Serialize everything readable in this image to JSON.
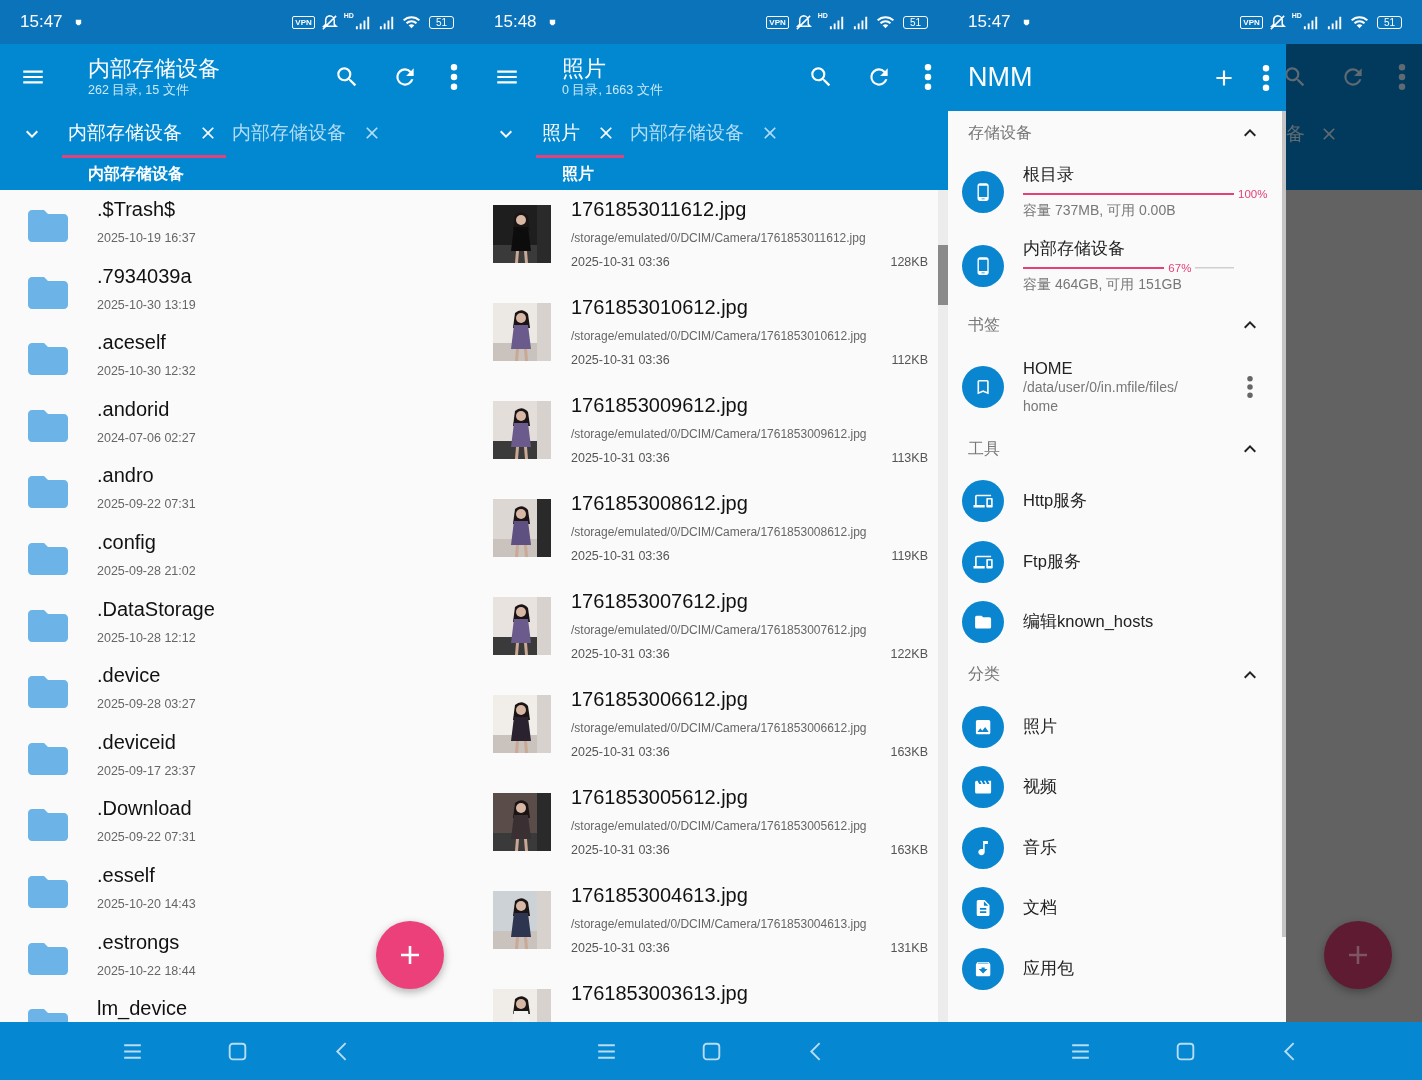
{
  "screens": [
    {
      "kind": "files",
      "status_bar": {
        "time": "15:47",
        "vpn": "VPN",
        "hd": "HD",
        "battery": "51"
      },
      "toolbar": {
        "title": "内部存储设备",
        "subtitle": "262 目录, 15 文件"
      },
      "tabs": [
        {
          "label": "内部存储设备",
          "selected": true
        },
        {
          "label": "内部存储设备",
          "selected": false
        }
      ],
      "breadcrumb": "内部存储设备",
      "fab": true,
      "items": [
        {
          "name": ".$Trash$",
          "date": "2025-10-19 16:37"
        },
        {
          "name": ".7934039a",
          "date": "2025-10-30 13:19"
        },
        {
          "name": ".aceself",
          "date": "2025-10-30 12:32"
        },
        {
          "name": ".andorid",
          "date": "2024-07-06 02:27"
        },
        {
          "name": ".andro",
          "date": "2025-09-22 07:31"
        },
        {
          "name": ".config",
          "date": "2025-09-28 21:02"
        },
        {
          "name": ".DataStorage",
          "date": "2025-10-28 12:12"
        },
        {
          "name": ".device",
          "date": "2025-09-28 03:27"
        },
        {
          "name": ".deviceid",
          "date": "2025-09-17 23:37"
        },
        {
          "name": ".Download",
          "date": "2025-09-22 07:31"
        },
        {
          "name": ".esself",
          "date": "2025-10-20 14:43"
        },
        {
          "name": ".estrongs",
          "date": "2025-10-22 18:44"
        },
        {
          "name": "lm_device"
        }
      ]
    },
    {
      "kind": "photos",
      "status_bar": {
        "time": "15:48",
        "vpn": "VPN",
        "hd": "HD",
        "battery": "51"
      },
      "toolbar": {
        "title": "照片",
        "subtitle": "0 目录, 1663 文件"
      },
      "tabs": [
        {
          "label": "照片",
          "selected": true
        },
        {
          "label": "内部存储设备",
          "selected": false
        }
      ],
      "breadcrumb": "照片",
      "items": [
        {
          "name": "1761853011612.jpg",
          "path": "/storage/emulated/0/DCIM/Camera/1761853011612.jpg",
          "date": "2025-10-31 03:36",
          "size": "128KB"
        },
        {
          "name": "1761853010612.jpg",
          "path": "/storage/emulated/0/DCIM/Camera/1761853010612.jpg",
          "date": "2025-10-31 03:36",
          "size": "112KB"
        },
        {
          "name": "1761853009612.jpg",
          "path": "/storage/emulated/0/DCIM/Camera/1761853009612.jpg",
          "date": "2025-10-31 03:36",
          "size": "113KB"
        },
        {
          "name": "1761853008612.jpg",
          "path": "/storage/emulated/0/DCIM/Camera/1761853008612.jpg",
          "date": "2025-10-31 03:36",
          "size": "119KB"
        },
        {
          "name": "1761853007612.jpg",
          "path": "/storage/emulated/0/DCIM/Camera/1761853007612.jpg",
          "date": "2025-10-31 03:36",
          "size": "122KB"
        },
        {
          "name": "1761853006612.jpg",
          "path": "/storage/emulated/0/DCIM/Camera/1761853006612.jpg",
          "date": "2025-10-31 03:36",
          "size": "163KB"
        },
        {
          "name": "1761853005612.jpg",
          "path": "/storage/emulated/0/DCIM/Camera/1761853005612.jpg",
          "date": "2025-10-31 03:36",
          "size": "163KB"
        },
        {
          "name": "1761853004613.jpg",
          "path": "/storage/emulated/0/DCIM/Camera/1761853004613.jpg",
          "date": "2025-10-31 03:36",
          "size": "131KB"
        },
        {
          "name": "1761853003613.jpg"
        }
      ]
    },
    {
      "kind": "drawer",
      "status_bar": {
        "time": "15:47",
        "vpn": "VPN",
        "hd": "HD",
        "battery": "51"
      },
      "fab": true,
      "background": {
        "tab_label": "备"
      },
      "drawer": {
        "title": "NMM",
        "sections": [
          {
            "title": "存储设备",
            "expanded": true,
            "items": [
              {
                "kind": "storage",
                "label": "根目录",
                "level": 1.0,
                "reading": "100%",
                "detail": "容量 737MB, 可用 0.00B"
              },
              {
                "kind": "storage",
                "label": "内部存储设备",
                "level": 0.67,
                "reading": "67%",
                "detail": "容量 464GB, 可用 151GB"
              }
            ]
          },
          {
            "title": "书签",
            "expanded": true,
            "items": [
              {
                "kind": "bookmark",
                "label": "HOME",
                "detail": "/data/user/0/in.mfile/files/home"
              }
            ]
          },
          {
            "title": "工具",
            "expanded": true,
            "items": [
              {
                "kind": "plain",
                "label": "Http服务"
              },
              {
                "kind": "plain",
                "label": "Ftp服务"
              },
              {
                "kind": "plain",
                "label": "编辑known_hosts"
              }
            ]
          },
          {
            "title": "分类",
            "expanded": true,
            "items": [
              {
                "kind": "plain",
                "label": "照片"
              },
              {
                "kind": "plain",
                "label": "视频"
              },
              {
                "kind": "plain",
                "label": "音乐"
              },
              {
                "kind": "plain",
                "label": "文档"
              },
              {
                "kind": "plain",
                "label": "应用包"
              }
            ]
          }
        ]
      }
    }
  ]
}
